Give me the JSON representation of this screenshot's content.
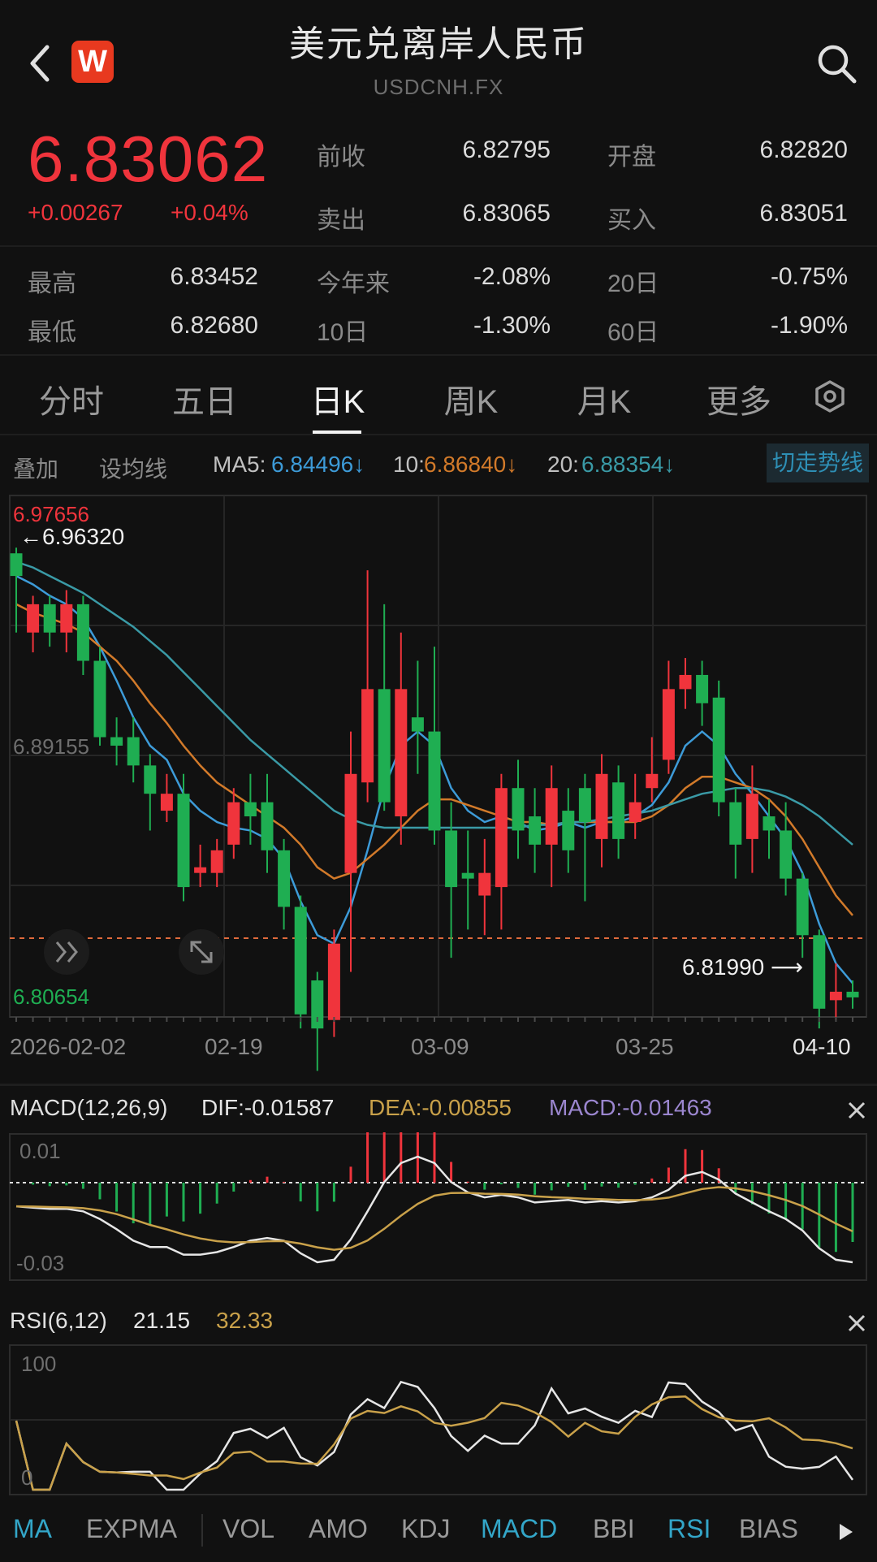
{
  "header": {
    "title": "美元兑离岸人民币",
    "subtitle": "USDCNH.FX",
    "logo_letter": "W"
  },
  "quote": {
    "price": "6.83062",
    "change": "+0.00267",
    "change_pct": "+0.04%",
    "prev_close_label": "前收",
    "prev_close": "6.82795",
    "open_label": "开盘",
    "open": "6.82820",
    "sell_label": "卖出",
    "sell": "6.83065",
    "buy_label": "买入",
    "buy": "6.83051",
    "high_label": "最高",
    "high": "6.83452",
    "low_label": "最低",
    "low": "6.82680",
    "ytd_label": "今年来",
    "ytd": "-2.08%",
    "d20_label": "20日",
    "d20": "-0.75%",
    "d10_label": "10日",
    "d10": "-1.30%",
    "d60_label": "60日",
    "d60": "-1.90%"
  },
  "tabs": [
    {
      "label": "分时"
    },
    {
      "label": "五日"
    },
    {
      "label": "日K"
    },
    {
      "label": "周K"
    },
    {
      "label": "月K"
    },
    {
      "label": "更多"
    }
  ],
  "ma_row": {
    "overlay": "叠加",
    "set_ma": "设均线",
    "ma5_label": "MA5:",
    "ma5": "6.84496↓",
    "ma10_label": "10:",
    "ma10": "6.86840↓",
    "ma20_label": "20:",
    "ma20": "6.88354↓",
    "switch": "切走势线"
  },
  "colors": {
    "up": "#f0343c",
    "down": "#1fae52",
    "ma5": "#3d9bd8",
    "ma10": "#d27a2a",
    "ma20": "#3a9aa6",
    "dif": "#e6e6e6",
    "dea": "#c9a14a",
    "macd": "#9b86cf",
    "accent": "#33a6c8"
  },
  "kline": {
    "max_label": "6.97656",
    "max_arrow": "←6.96320",
    "mid_label": "6.89155",
    "min_label": "6.80654",
    "low_arrow": "6.81990 ⟶",
    "dates": [
      "2026-02-02",
      "02-19",
      "03-09",
      "03-25",
      "04-10"
    ]
  },
  "macd": {
    "title": "MACD(12,26,9)",
    "dif": "DIF:-0.01587",
    "dea": "DEA:-0.00855",
    "macd": "MACD:-0.01463",
    "top_label": "0.01",
    "bottom_label": "-0.03"
  },
  "rsi": {
    "title": "RSI(6,12)",
    "v1": "21.15",
    "v2": "32.33",
    "top_label": "100",
    "bottom_label": "0"
  },
  "indicators": [
    {
      "label": "MA"
    },
    {
      "label": "EXPMA"
    },
    {
      "label": "VOL"
    },
    {
      "label": "AMO"
    },
    {
      "label": "KDJ"
    },
    {
      "label": "MACD"
    },
    {
      "label": "BBI"
    },
    {
      "label": "RSI"
    },
    {
      "label": "BIAS"
    }
  ],
  "chart_data": {
    "type": "candlestick",
    "y_range": [
      6.80654,
      6.97656
    ],
    "candles": [
      [
        6.963,
        6.955,
        6.965,
        6.935
      ],
      [
        6.935,
        6.945,
        6.948,
        6.928
      ],
      [
        6.945,
        6.935,
        6.948,
        6.93
      ],
      [
        6.935,
        6.945,
        6.95,
        6.928
      ],
      [
        6.945,
        6.925,
        6.948,
        6.92
      ],
      [
        6.925,
        6.898,
        6.93,
        6.895
      ],
      [
        6.898,
        6.895,
        6.905,
        6.888
      ],
      [
        6.898,
        6.888,
        6.905,
        6.882
      ],
      [
        6.888,
        6.878,
        6.892,
        6.865
      ],
      [
        6.872,
        6.878,
        6.885,
        6.868
      ],
      [
        6.878,
        6.845,
        6.885,
        6.84
      ],
      [
        6.85,
        6.852,
        6.86,
        6.845
      ],
      [
        6.85,
        6.858,
        6.862,
        6.845
      ],
      [
        6.86,
        6.875,
        6.88,
        6.855
      ],
      [
        6.875,
        6.87,
        6.885,
        6.86
      ],
      [
        6.875,
        6.858,
        6.885,
        6.85
      ],
      [
        6.858,
        6.838,
        6.862,
        6.83
      ],
      [
        6.838,
        6.8,
        6.842,
        6.795
      ],
      [
        6.812,
        6.795,
        6.815,
        6.78
      ],
      [
        6.798,
        6.825,
        6.83,
        6.792
      ],
      [
        6.85,
        6.885,
        6.9,
        6.815
      ],
      [
        6.882,
        6.915,
        6.957,
        6.875
      ],
      [
        6.915,
        6.875,
        6.945,
        6.872
      ],
      [
        6.87,
        6.915,
        6.935,
        6.86
      ],
      [
        6.905,
        6.9,
        6.925,
        6.885
      ],
      [
        6.9,
        6.865,
        6.93,
        6.86
      ],
      [
        6.865,
        6.845,
        6.875,
        6.82
      ],
      [
        6.85,
        6.848,
        6.865,
        6.83
      ],
      [
        6.842,
        6.85,
        6.862,
        6.828
      ],
      [
        6.845,
        6.88,
        6.885,
        6.83
      ],
      [
        6.88,
        6.865,
        6.89,
        6.855
      ],
      [
        6.87,
        6.86,
        6.88,
        6.85
      ],
      [
        6.86,
        6.88,
        6.888,
        6.845
      ],
      [
        6.872,
        6.858,
        6.88,
        6.85
      ],
      [
        6.88,
        6.868,
        6.885,
        6.84
      ],
      [
        6.862,
        6.885,
        6.892,
        6.852
      ],
      [
        6.882,
        6.862,
        6.888,
        6.855
      ],
      [
        6.868,
        6.875,
        6.885,
        6.862
      ],
      [
        6.88,
        6.885,
        6.898,
        6.875
      ],
      [
        6.89,
        6.915,
        6.925,
        6.885
      ],
      [
        6.915,
        6.92,
        6.926,
        6.908
      ],
      [
        6.92,
        6.91,
        6.925,
        6.902
      ],
      [
        6.912,
        6.875,
        6.918,
        6.87
      ],
      [
        6.875,
        6.86,
        6.88,
        6.848
      ],
      [
        6.862,
        6.878,
        6.888,
        6.85
      ],
      [
        6.87,
        6.865,
        6.876,
        6.855
      ],
      [
        6.865,
        6.848,
        6.875,
        6.842
      ],
      [
        6.848,
        6.828,
        6.85,
        6.82
      ],
      [
        6.828,
        6.802,
        6.83,
        6.795
      ],
      [
        6.805,
        6.808,
        6.818,
        6.798
      ],
      [
        6.808,
        6.806,
        6.812,
        6.802
      ]
    ],
    "ma5": [
      6.955,
      6.952,
      6.948,
      6.945,
      6.94,
      6.93,
      6.918,
      6.905,
      6.895,
      6.89,
      6.878,
      6.872,
      6.868,
      6.866,
      6.865,
      6.862,
      6.855,
      6.84,
      6.828,
      6.825,
      6.838,
      6.858,
      6.88,
      6.895,
      6.9,
      6.895,
      6.88,
      6.872,
      6.868,
      6.87,
      6.868,
      6.865,
      6.866,
      6.868,
      6.866,
      6.868,
      6.868,
      6.87,
      6.874,
      6.882,
      6.895,
      6.9,
      6.895,
      6.885,
      6.878,
      6.87,
      6.862,
      6.85,
      6.832,
      6.818,
      6.811
    ],
    "ma10": [
      6.945,
      6.942,
      6.94,
      6.938,
      6.935,
      6.93,
      6.925,
      6.918,
      6.91,
      6.903,
      6.895,
      6.888,
      6.882,
      6.878,
      6.874,
      6.87,
      6.866,
      6.86,
      6.852,
      6.848,
      6.85,
      6.855,
      6.86,
      6.866,
      6.872,
      6.876,
      6.876,
      6.874,
      6.872,
      6.87,
      6.868,
      6.868,
      6.867,
      6.868,
      6.868,
      6.868,
      6.868,
      6.868,
      6.87,
      6.874,
      6.88,
      6.884,
      6.884,
      6.882,
      6.88,
      6.876,
      6.87,
      6.862,
      6.852,
      6.842,
      6.835
    ],
    "ma20": [
      6.96,
      6.958,
      6.955,
      6.952,
      6.949,
      6.945,
      6.941,
      6.937,
      6.932,
      6.927,
      6.921,
      6.915,
      6.909,
      6.903,
      6.897,
      6.892,
      6.887,
      6.882,
      6.877,
      6.872,
      6.869,
      6.867,
      6.866,
      6.866,
      6.866,
      6.866,
      6.866,
      6.866,
      6.866,
      6.866,
      6.866,
      6.867,
      6.867,
      6.868,
      6.868,
      6.869,
      6.87,
      6.871,
      6.872,
      6.874,
      6.876,
      6.878,
      6.879,
      6.88,
      6.88,
      6.879,
      6.877,
      6.874,
      6.87,
      6.865,
      6.86
    ]
  }
}
